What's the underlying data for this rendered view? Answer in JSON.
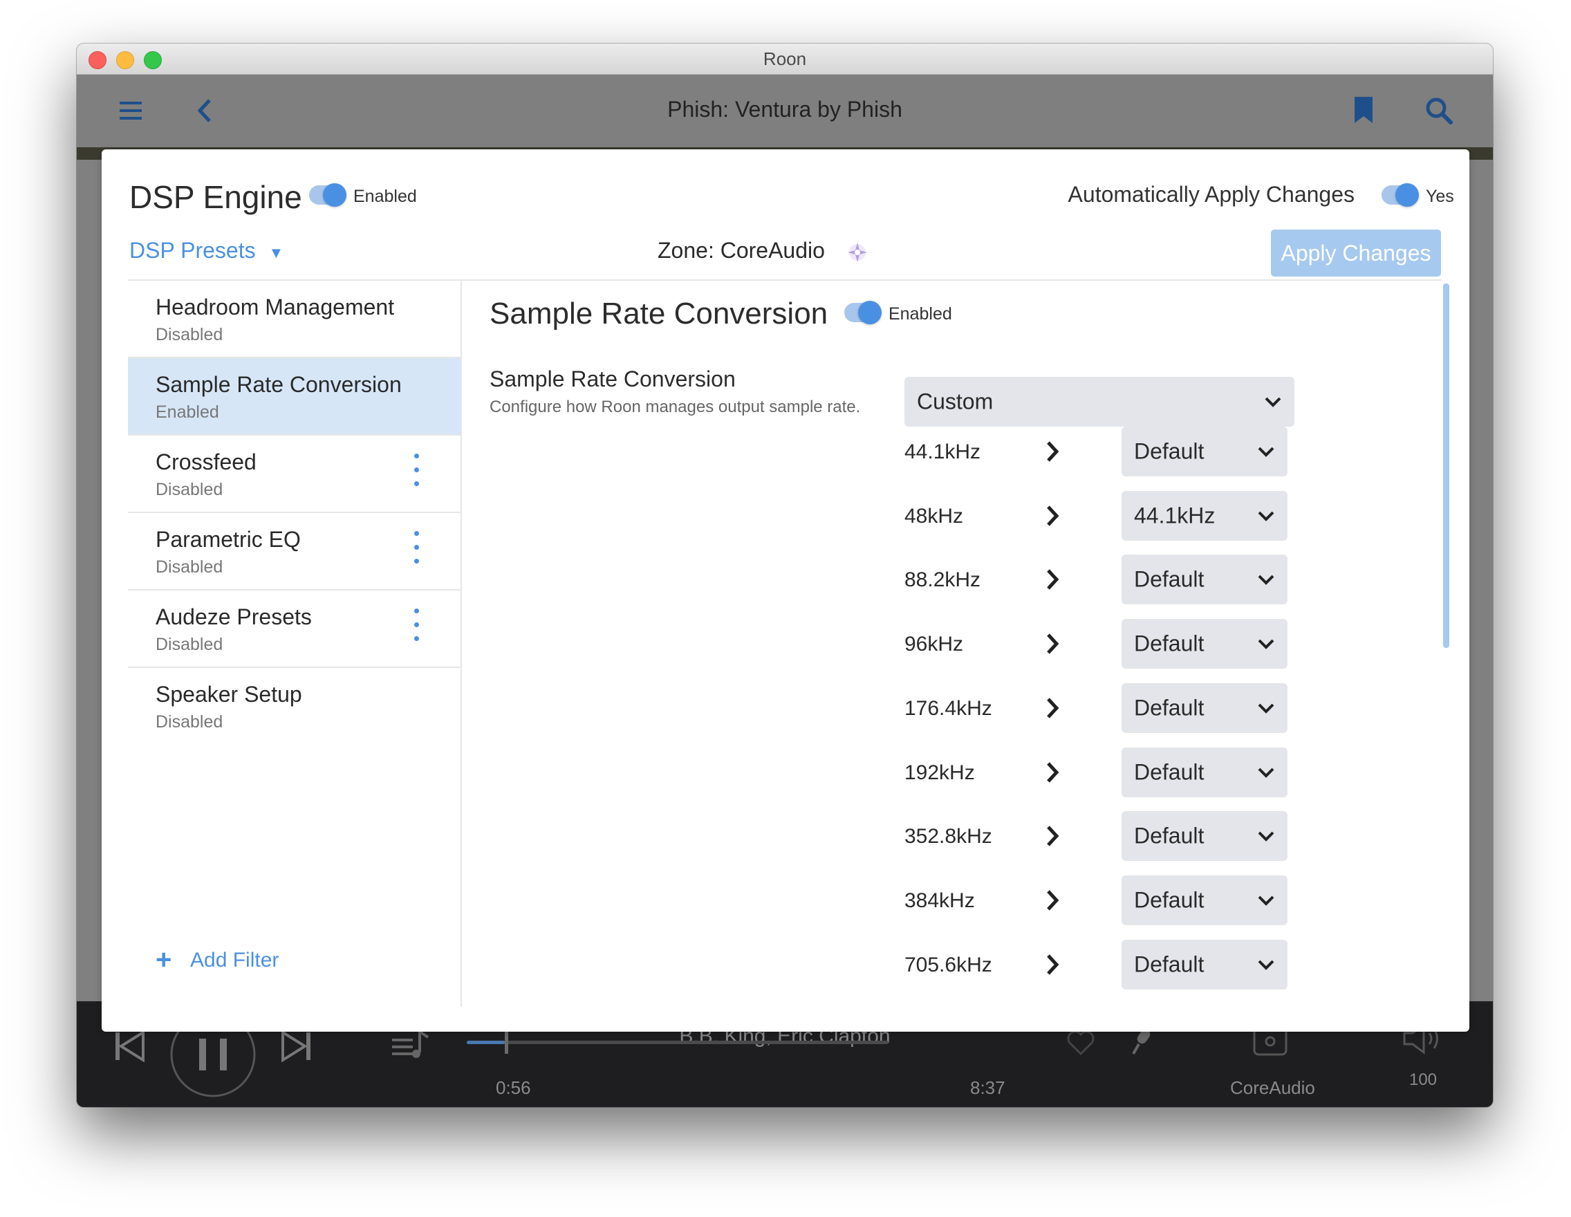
{
  "window": {
    "title": "Roon"
  },
  "appbar": {
    "title": "Phish: Ventura by Phish"
  },
  "player": {
    "artist": "B.B. King, Eric Clapton",
    "elapsed": "0:56",
    "duration": "8:37",
    "progress_fraction": 0.09,
    "zone": "CoreAudio",
    "volume": "100"
  },
  "dsp": {
    "title": "DSP Engine",
    "status": "Enabled",
    "auto_apply_label": "Automatically Apply Changes",
    "auto_apply_value": "Yes",
    "presets_label": "DSP Presets",
    "zone_label": "Zone: CoreAudio",
    "apply_button": "Apply Changes",
    "add_filter": "Add Filter"
  },
  "filters": [
    {
      "name": "Headroom Management",
      "status": "Disabled"
    },
    {
      "name": "Sample Rate Conversion",
      "status": "Enabled"
    },
    {
      "name": "Crossfeed",
      "status": "Disabled"
    },
    {
      "name": "Parametric EQ",
      "status": "Disabled"
    },
    {
      "name": "Audeze Presets",
      "status": "Disabled"
    },
    {
      "name": "Speaker Setup",
      "status": "Disabled"
    }
  ],
  "src": {
    "title": "Sample Rate Conversion",
    "status": "Enabled",
    "setting_title": "Sample Rate Conversion",
    "setting_desc": "Configure how Roon manages output sample rate.",
    "mode": "Custom",
    "rates": [
      {
        "from": "44.1kHz",
        "to": "Default"
      },
      {
        "from": "48kHz",
        "to": "44.1kHz"
      },
      {
        "from": "88.2kHz",
        "to": "Default"
      },
      {
        "from": "96kHz",
        "to": "Default"
      },
      {
        "from": "176.4kHz",
        "to": "Default"
      },
      {
        "from": "192kHz",
        "to": "Default"
      },
      {
        "from": "352.8kHz",
        "to": "Default"
      },
      {
        "from": "384kHz",
        "to": "Default"
      },
      {
        "from": "705.6kHz",
        "to": "Default"
      }
    ]
  },
  "colors": {
    "accent": "#4a90e2",
    "selected_bg": "#d6e6f7",
    "apply_disabled": "#a6c9ef"
  }
}
